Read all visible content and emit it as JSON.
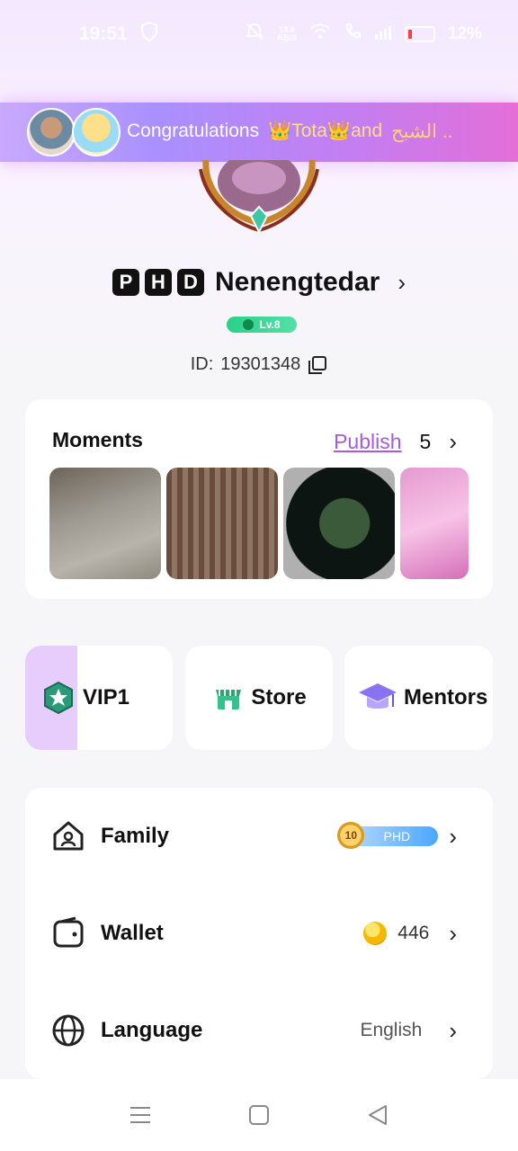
{
  "status_bar": {
    "time": "19:51",
    "net_speed_value": "18.0",
    "net_speed_unit": "KB/S",
    "battery": "12%"
  },
  "banner": {
    "congrats": "Congratulations",
    "names": "👑Tota👑and",
    "arabic": "الشبح .."
  },
  "profile": {
    "badge_letters": [
      "P",
      "H",
      "D"
    ],
    "name": "Nenengtedar",
    "level": "Lv.8",
    "id_label": "ID:",
    "id_value": "19301348"
  },
  "moments": {
    "title": "Moments",
    "publish": "Publish",
    "count": "5"
  },
  "quick_actions": {
    "vip": "VIP1",
    "store": "Store",
    "mentors": "Mentors"
  },
  "menu": {
    "family": {
      "label": "Family",
      "badge_level": "10",
      "badge_text": "PHD"
    },
    "wallet": {
      "label": "Wallet",
      "balance": "446"
    },
    "language": {
      "label": "Language",
      "value": "English"
    }
  },
  "icons": {
    "chevron": "chevron-right-icon",
    "copy": "copy-icon",
    "coin": "coin-icon"
  },
  "colors": {
    "accent_purple": "#a45bdc",
    "vip_accent": "#e7cdfb",
    "level_green": "#2ad08a"
  }
}
